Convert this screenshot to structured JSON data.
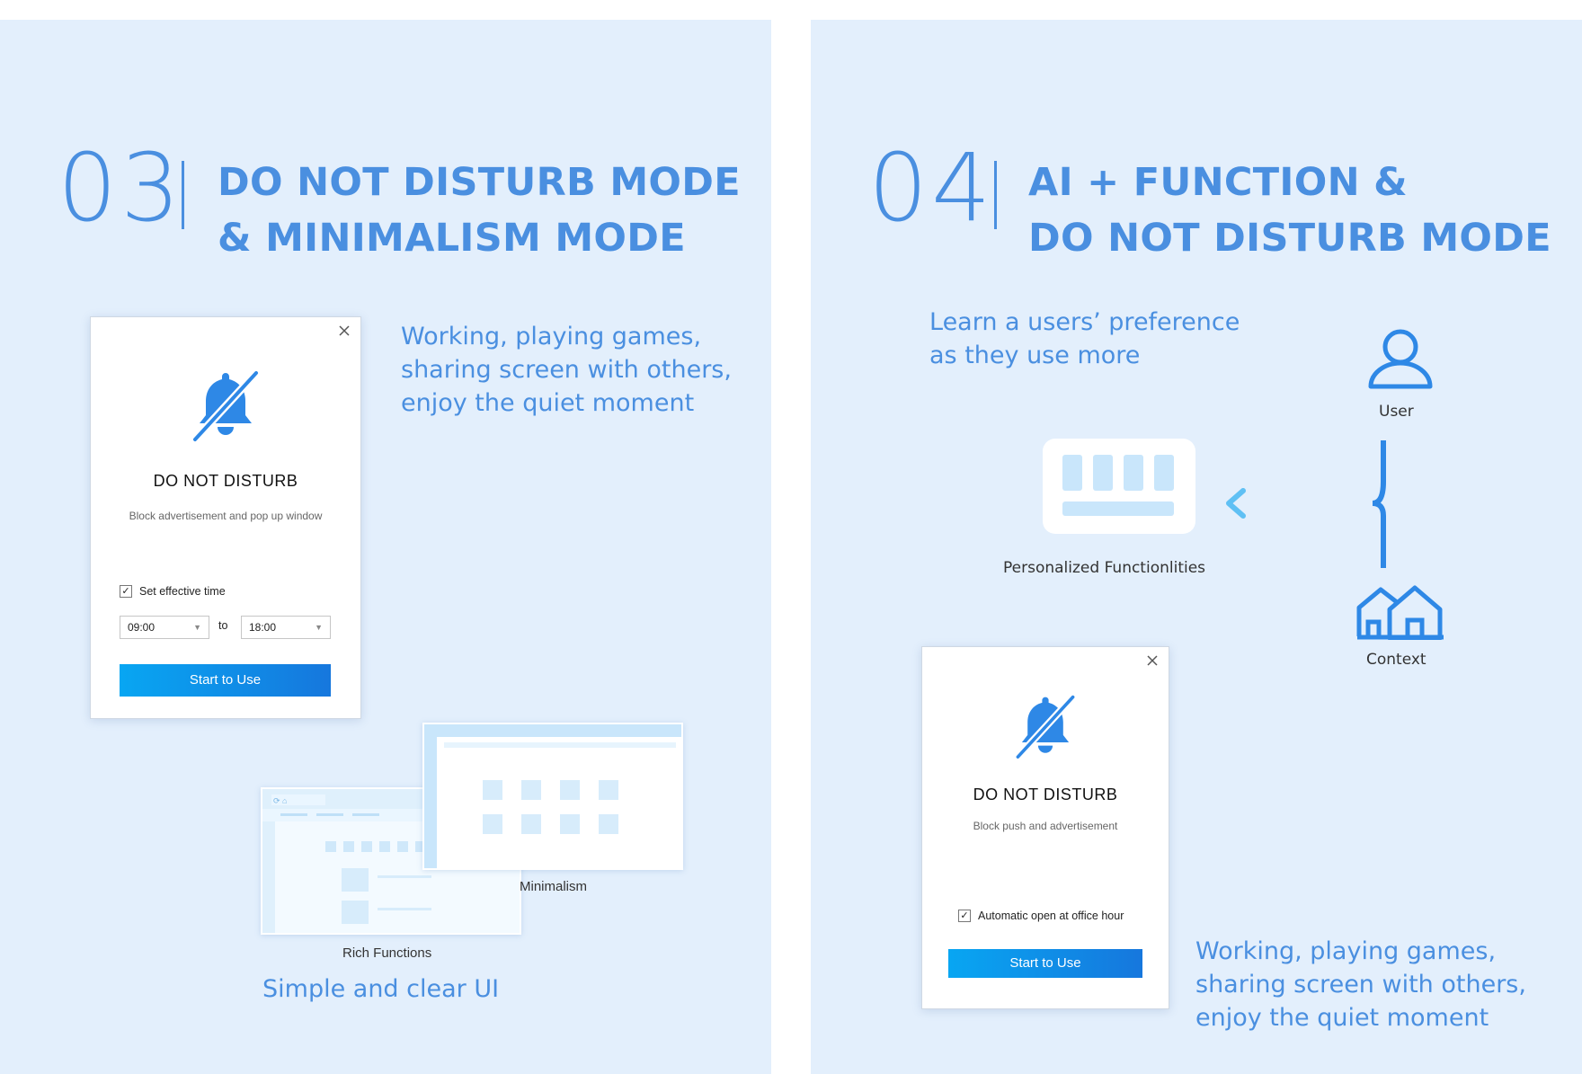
{
  "section3": {
    "number": "03",
    "title_line1": "DO NOT DISTURB MODE",
    "title_line2": "& MINIMALISM MODE",
    "blurb": [
      "Working, playing games,",
      "sharing screen with others,",
      "enjoy the quiet moment"
    ],
    "dialog": {
      "close_icon": "close-icon",
      "bell_icon": "bell-slash-icon",
      "title": "DO NOT DISTURB",
      "subtitle": "Block advertisement and pop up window",
      "checkbox_label": "Set effective time",
      "checkbox_checked": true,
      "from_time": "09:00",
      "separator": "to",
      "to_time": "18:00",
      "start_button": "Start to Use"
    },
    "mock_rich_label": "Rich Functions",
    "mock_minimal_label": "Minimalism",
    "footer": "Simple and clear UI"
  },
  "section4": {
    "number": "04",
    "title_line1": "AI + FUNCTION &",
    "title_line2": "DO NOT DISTURB MODE",
    "learn_text": [
      "Learn a users’ preference",
      "as they use more"
    ],
    "user_label": "User",
    "user_icon": "user-icon",
    "context_label": "Context",
    "context_icon": "houses-icon",
    "functions_label": "Personalized Functionlities",
    "functions_icon": "functions-panel-icon",
    "dialog": {
      "close_icon": "close-icon",
      "bell_icon": "bell-slash-icon",
      "title": "DO NOT DISTURB",
      "subtitle": "Block push and advertisement",
      "checkbox_label": "Automatic open at office hour",
      "checkbox_checked": true,
      "start_button": "Start to Use"
    },
    "blurb": [
      "Working, playing games,",
      "sharing screen with others,",
      "enjoy the quiet moment"
    ]
  },
  "colors": {
    "accent": "#4a8fe0",
    "panel_bg": "#e3effc",
    "button_gradient_start": "#08a6f2",
    "button_gradient_end": "#1677dd",
    "bell_blue": "#2e88e6",
    "tile_blue": "#c9e6fb"
  }
}
